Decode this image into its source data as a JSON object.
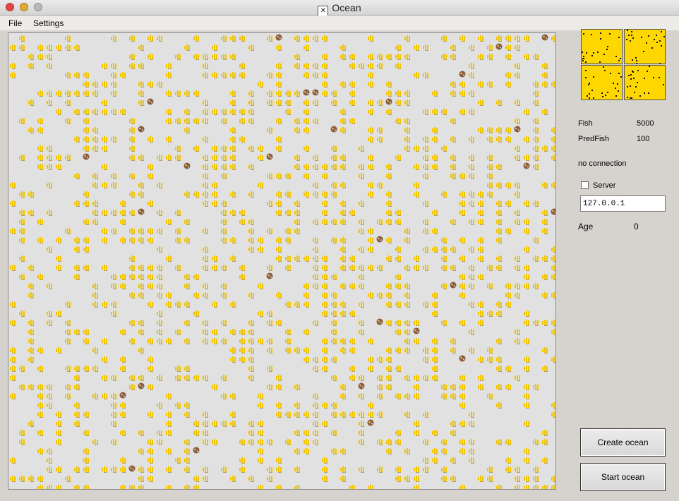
{
  "window": {
    "title": "Ocean"
  },
  "menu": {
    "file": "File",
    "settings": "Settings"
  },
  "ocean": {
    "background": "#e1e1e1",
    "fish_color": "#f0c400",
    "predator_color": "#8a5a3a"
  },
  "stats": {
    "fish_label": "Fish",
    "fish_value": "5000",
    "predfish_label": "PredFish",
    "predfish_value": "100",
    "connection_status": "no connection",
    "age_label": "Age",
    "age_value": "0"
  },
  "server": {
    "checkbox_label": "Server",
    "checked": false,
    "ip_value": "127.0.0.1"
  },
  "buttons": {
    "create": "Create ocean",
    "start": "Start ocean"
  },
  "minimap": {
    "background": "#ffd700",
    "dot_color": "#111111"
  }
}
